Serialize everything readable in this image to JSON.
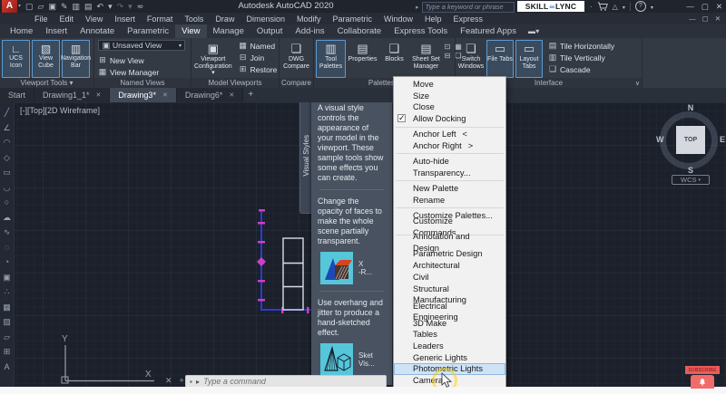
{
  "title_bar": {
    "app_title": "Autodesk AutoCAD 2020",
    "search_placeholder": "Type a keyword or phrase",
    "brand": {
      "skill": "SKILL",
      "link": "∞",
      "lync": "LYNC"
    },
    "account_icon": "△",
    "help_icon": "?",
    "qat_icons": [
      {
        "g": "▢",
        "name": "new-file-icon"
      },
      {
        "g": "▱",
        "name": "open-file-icon"
      },
      {
        "g": "▣",
        "name": "save-icon"
      },
      {
        "g": "✎",
        "name": "save-as-icon"
      },
      {
        "g": "▥",
        "name": "plot-icon"
      },
      {
        "g": "▤",
        "name": "print-icon"
      },
      {
        "g": "↶",
        "name": "undo-icon"
      },
      {
        "g": "▾",
        "name": "undo-dropdown-icon"
      },
      {
        "g": "↷",
        "name": "redo-icon",
        "dim": true
      },
      {
        "g": "▾",
        "name": "redo-dropdown-icon",
        "dim": true
      },
      {
        "g": "≂",
        "name": "qat-customize-icon"
      }
    ]
  },
  "menu_bar": {
    "items": [
      "File",
      "Edit",
      "View",
      "Insert",
      "Format",
      "Tools",
      "Draw",
      "Dimension",
      "Modify",
      "Parametric",
      "Window",
      "Help",
      "Express"
    ]
  },
  "ribbon": {
    "tabs": [
      {
        "label": "Home"
      },
      {
        "label": "Insert"
      },
      {
        "label": "Annotate"
      },
      {
        "label": "Parametric"
      },
      {
        "label": "View",
        "active": true
      },
      {
        "label": "Manage"
      },
      {
        "label": "Output"
      },
      {
        "label": "Add-ins"
      },
      {
        "label": "Collaborate"
      },
      {
        "label": "Express Tools"
      },
      {
        "label": "Featured Apps"
      }
    ],
    "panels": {
      "viewport_tools": {
        "label": "Viewport Tools ▾",
        "buttons": [
          {
            "icon": "∟",
            "label": "UCS Icon",
            "active": true,
            "name": "ucs-icon-toggle"
          },
          {
            "icon": "▧",
            "label": "View Cube",
            "active": true,
            "name": "view-cube-toggle"
          },
          {
            "icon": "▥",
            "label": "Navigation Bar",
            "active": true,
            "name": "navigation-bar-toggle"
          }
        ]
      },
      "named_views": {
        "label": "Named Views",
        "dropdown": {
          "icon": "▣",
          "value": "Unsaved View"
        },
        "items": [
          {
            "icon": "⊞",
            "label": "New View",
            "name": "new-view-button"
          },
          {
            "icon": "▦",
            "label": "View Manager",
            "name": "view-manager-button"
          }
        ]
      },
      "model_viewports": {
        "label": "Model Viewports",
        "main": {
          "icon": "▣",
          "label": "Viewport Configuration ▾"
        },
        "items": [
          {
            "icon": "▦",
            "label": "Named",
            "name": "named-viewports-button"
          },
          {
            "icon": "⊟",
            "label": "Join",
            "name": "join-viewports-button"
          },
          {
            "icon": "⊞",
            "label": "Restore",
            "name": "restore-viewports-button"
          }
        ]
      },
      "compare": {
        "label": "Compare",
        "main": {
          "icon": "❏",
          "label": "DWG Compare"
        }
      },
      "palettes": {
        "label": "Palettes ▾",
        "buttons": [
          {
            "icon": "▥",
            "label": "Tool Palettes",
            "active": true,
            "name": "tool-palettes-button"
          },
          {
            "icon": "▤",
            "label": "Properties",
            "name": "properties-button"
          },
          {
            "icon": "❑",
            "label": "Blocks",
            "name": "blocks-button"
          },
          {
            "icon": "▤",
            "label": "Sheet Set Manager",
            "name": "sheet-set-manager-button"
          }
        ],
        "extra_icons": [
          {
            "g": "⊡",
            "name": "palette-extra-icon-1"
          },
          {
            "g": "▦",
            "name": "palette-extra-icon-2"
          },
          {
            "g": "⊟",
            "name": "palette-extra-icon-3"
          },
          {
            "g": "❏",
            "name": "palette-extra-icon-4"
          }
        ]
      },
      "interface": {
        "label": "Interface",
        "buttons": [
          {
            "icon": "❏",
            "label": "Switch Windows",
            "name": "switch-windows-button"
          },
          {
            "icon": "▭",
            "label": "File Tabs",
            "active": true,
            "name": "file-tabs-toggle"
          },
          {
            "icon": "▭",
            "label": "Layout Tabs",
            "active": true,
            "name": "layout-tabs-toggle"
          }
        ],
        "menu_items": [
          {
            "icon": "▤",
            "label": "Tile Horizontally",
            "name": "tile-horizontally-button"
          },
          {
            "icon": "▥",
            "label": "Tile Vertically",
            "name": "tile-vertically-button"
          },
          {
            "icon": "❏",
            "label": "Cascade",
            "name": "cascade-button"
          }
        ]
      }
    }
  },
  "file_tabs": {
    "tabs": [
      {
        "label": "Start",
        "name": "tab-start"
      },
      {
        "label": "Drawing1_1*",
        "closable": true,
        "name": "tab-drawing1-1"
      },
      {
        "label": "Drawing3*",
        "closable": true,
        "active": true,
        "name": "tab-drawing3"
      },
      {
        "label": "Drawing6*",
        "closable": true,
        "name": "tab-drawing6"
      }
    ]
  },
  "left_toolbar": {
    "icons": [
      {
        "g": "╱",
        "name": "line-tool-icon"
      },
      {
        "g": "∠",
        "name": "polyline-tool-icon"
      },
      {
        "g": "◠",
        "name": "arc-tool-icon"
      },
      {
        "g": "◇",
        "name": "polygon-tool-icon"
      },
      {
        "g": "▭",
        "name": "rectangle-tool-icon"
      },
      {
        "g": "◡",
        "name": "arc-3point-tool-icon"
      },
      {
        "g": "○",
        "name": "circle-tool-icon"
      },
      {
        "g": "☁",
        "name": "revision-cloud-tool-icon"
      },
      {
        "g": "∿",
        "name": "spline-tool-icon"
      },
      {
        "g": "◌",
        "name": "ellipse-tool-icon"
      },
      {
        "g": "◔",
        "name": "ellipse-arc-tool-icon"
      },
      {
        "g": "▣",
        "name": "insert-block-tool-icon"
      },
      {
        "g": "∴",
        "name": "point-tool-icon"
      },
      {
        "g": "▦",
        "name": "hatch-tool-icon"
      },
      {
        "g": "▨",
        "name": "gradient-tool-icon"
      },
      {
        "g": "▱",
        "name": "region-tool-icon"
      },
      {
        "g": "⊞",
        "name": "table-tool-icon"
      },
      {
        "g": "A",
        "name": "text-tool-icon"
      }
    ]
  },
  "viewport": {
    "corner_label": "[-][Top][2D Wireframe]",
    "axis_x": "X",
    "axis_y": "Y"
  },
  "viewcube": {
    "north": "N",
    "south": "S",
    "east": "E",
    "west": "W",
    "center": "TOP",
    "wcs": "WCS"
  },
  "palette": {
    "tab": "Visual Styles",
    "intro": "A visual style controls the appearance of your model in the viewport. These sample tools show some effects you can create.",
    "section1_text": "Change the opacity of faces to make the whole scene partially transparent.",
    "tool1_label": "X\n-R...",
    "section2_text": "Use overhang and jitter to produce a hand-sketched effect.",
    "tool2_label": "Sket\nVis..."
  },
  "context_menu": {
    "items": [
      {
        "label": "Move"
      },
      {
        "label": "Size"
      },
      {
        "label": "Close"
      },
      {
        "label": "Allow Docking",
        "checked": true
      },
      {
        "separator": true
      },
      {
        "label": "Anchor Left",
        "suffix": "<"
      },
      {
        "label": "Anchor Right",
        "suffix": ">"
      },
      {
        "separator": true
      },
      {
        "label": "Auto-hide"
      },
      {
        "label": "Transparency..."
      },
      {
        "separator": true
      },
      {
        "label": "New Palette"
      },
      {
        "label": "Rename"
      },
      {
        "separator": true
      },
      {
        "label": "Customize Palettes..."
      },
      {
        "label": "Customize Commands..."
      },
      {
        "separator": true
      },
      {
        "label": "Annotation and Design"
      },
      {
        "label": "Parametric Design"
      },
      {
        "label": "Architectural"
      },
      {
        "label": "Civil"
      },
      {
        "label": "Structural"
      },
      {
        "label": "Manufacturing"
      },
      {
        "label": "Electrical Engineering"
      },
      {
        "label": "3D Make"
      },
      {
        "label": "Tables"
      },
      {
        "label": "Leaders"
      },
      {
        "label": "Generic Lights"
      },
      {
        "label": "Photometric Lights",
        "highlighted": true
      },
      {
        "label": "Cameras"
      }
    ]
  },
  "command_line": {
    "placeholder": "Type a command"
  },
  "overlay": {
    "subscribe_label": "SUBSCRIBE"
  },
  "colors": {
    "selection_blue": "#5b9bd5",
    "menu_highlight": "#cfe3f7",
    "tool_icon_cyan": "#56c6db",
    "brand_red": "#c4262b",
    "polyline_blue": "#2b3bd0",
    "grip_magenta": "#cc3fcc"
  }
}
